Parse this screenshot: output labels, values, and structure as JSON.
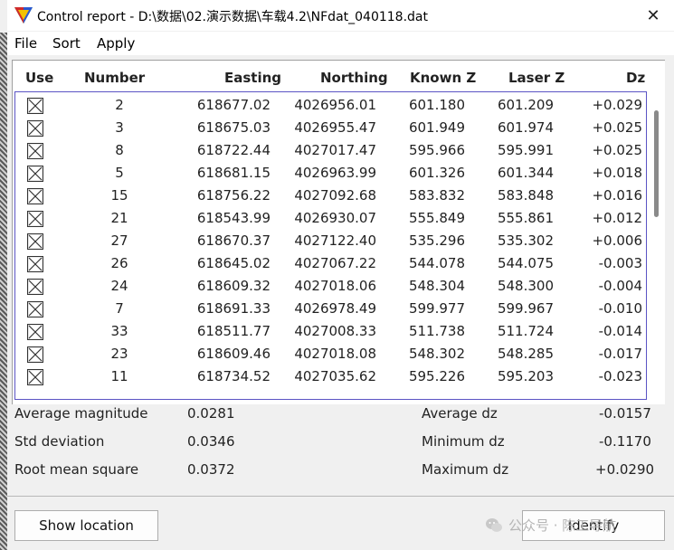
{
  "window": {
    "title": "Control report - D:\\数据\\02.演示数据\\车载4.2\\NFdat_040118.dat",
    "close_symbol": "✕",
    "icon": "app-triangle-icon"
  },
  "menu": {
    "items": [
      "File",
      "Sort",
      "Apply"
    ]
  },
  "table": {
    "headers": {
      "use": "Use",
      "number": "Number",
      "easting": "Easting",
      "northing": "Northing",
      "known_z": "Known Z",
      "laser_z": "Laser Z",
      "dz": "Dz"
    },
    "rows": [
      {
        "number": "2",
        "easting": "618677.02",
        "northing": "4026956.01",
        "known_z": "601.180",
        "laser_z": "601.209",
        "dz": "+0.029"
      },
      {
        "number": "3",
        "easting": "618675.03",
        "northing": "4026955.47",
        "known_z": "601.949",
        "laser_z": "601.974",
        "dz": "+0.025"
      },
      {
        "number": "8",
        "easting": "618722.44",
        "northing": "4027017.47",
        "known_z": "595.966",
        "laser_z": "595.991",
        "dz": "+0.025"
      },
      {
        "number": "5",
        "easting": "618681.15",
        "northing": "4026963.99",
        "known_z": "601.326",
        "laser_z": "601.344",
        "dz": "+0.018"
      },
      {
        "number": "15",
        "easting": "618756.22",
        "northing": "4027092.68",
        "known_z": "583.832",
        "laser_z": "583.848",
        "dz": "+0.016"
      },
      {
        "number": "21",
        "easting": "618543.99",
        "northing": "4026930.07",
        "known_z": "555.849",
        "laser_z": "555.861",
        "dz": "+0.012"
      },
      {
        "number": "27",
        "easting": "618670.37",
        "northing": "4027122.40",
        "known_z": "535.296",
        "laser_z": "535.302",
        "dz": "+0.006"
      },
      {
        "number": "26",
        "easting": "618645.02",
        "northing": "4027067.22",
        "known_z": "544.078",
        "laser_z": "544.075",
        "dz": "-0.003"
      },
      {
        "number": "24",
        "easting": "618609.32",
        "northing": "4027018.06",
        "known_z": "548.304",
        "laser_z": "548.300",
        "dz": "-0.004"
      },
      {
        "number": "7",
        "easting": "618691.33",
        "northing": "4026978.49",
        "known_z": "599.977",
        "laser_z": "599.967",
        "dz": "-0.010"
      },
      {
        "number": "33",
        "easting": "618511.77",
        "northing": "4027008.33",
        "known_z": "511.738",
        "laser_z": "511.724",
        "dz": "-0.014"
      },
      {
        "number": "23",
        "easting": "618609.46",
        "northing": "4027018.08",
        "known_z": "548.302",
        "laser_z": "548.285",
        "dz": "-0.017"
      },
      {
        "number": "11",
        "easting": "618734.52",
        "northing": "4027035.62",
        "known_z": "595.226",
        "laser_z": "595.203",
        "dz": "-0.023"
      }
    ]
  },
  "stats": {
    "average_magnitude": {
      "label": "Average magnitude",
      "value": "0.0281"
    },
    "std_deviation": {
      "label": "Std deviation",
      "value": "0.0346"
    },
    "root_mean_square": {
      "label": "Root mean square",
      "value": "0.0372"
    },
    "average_dz": {
      "label": "Average dz",
      "value": "-0.0157"
    },
    "minimum_dz": {
      "label": "Minimum dz",
      "value": "-0.1170"
    },
    "maximum_dz": {
      "label": "Maximum dz",
      "value": "+0.0290"
    }
  },
  "buttons": {
    "show_location": "Show location",
    "identify": "Identify"
  },
  "watermark": {
    "text": "公众号 · 陈工导航",
    "icon": "wechat-icon"
  }
}
